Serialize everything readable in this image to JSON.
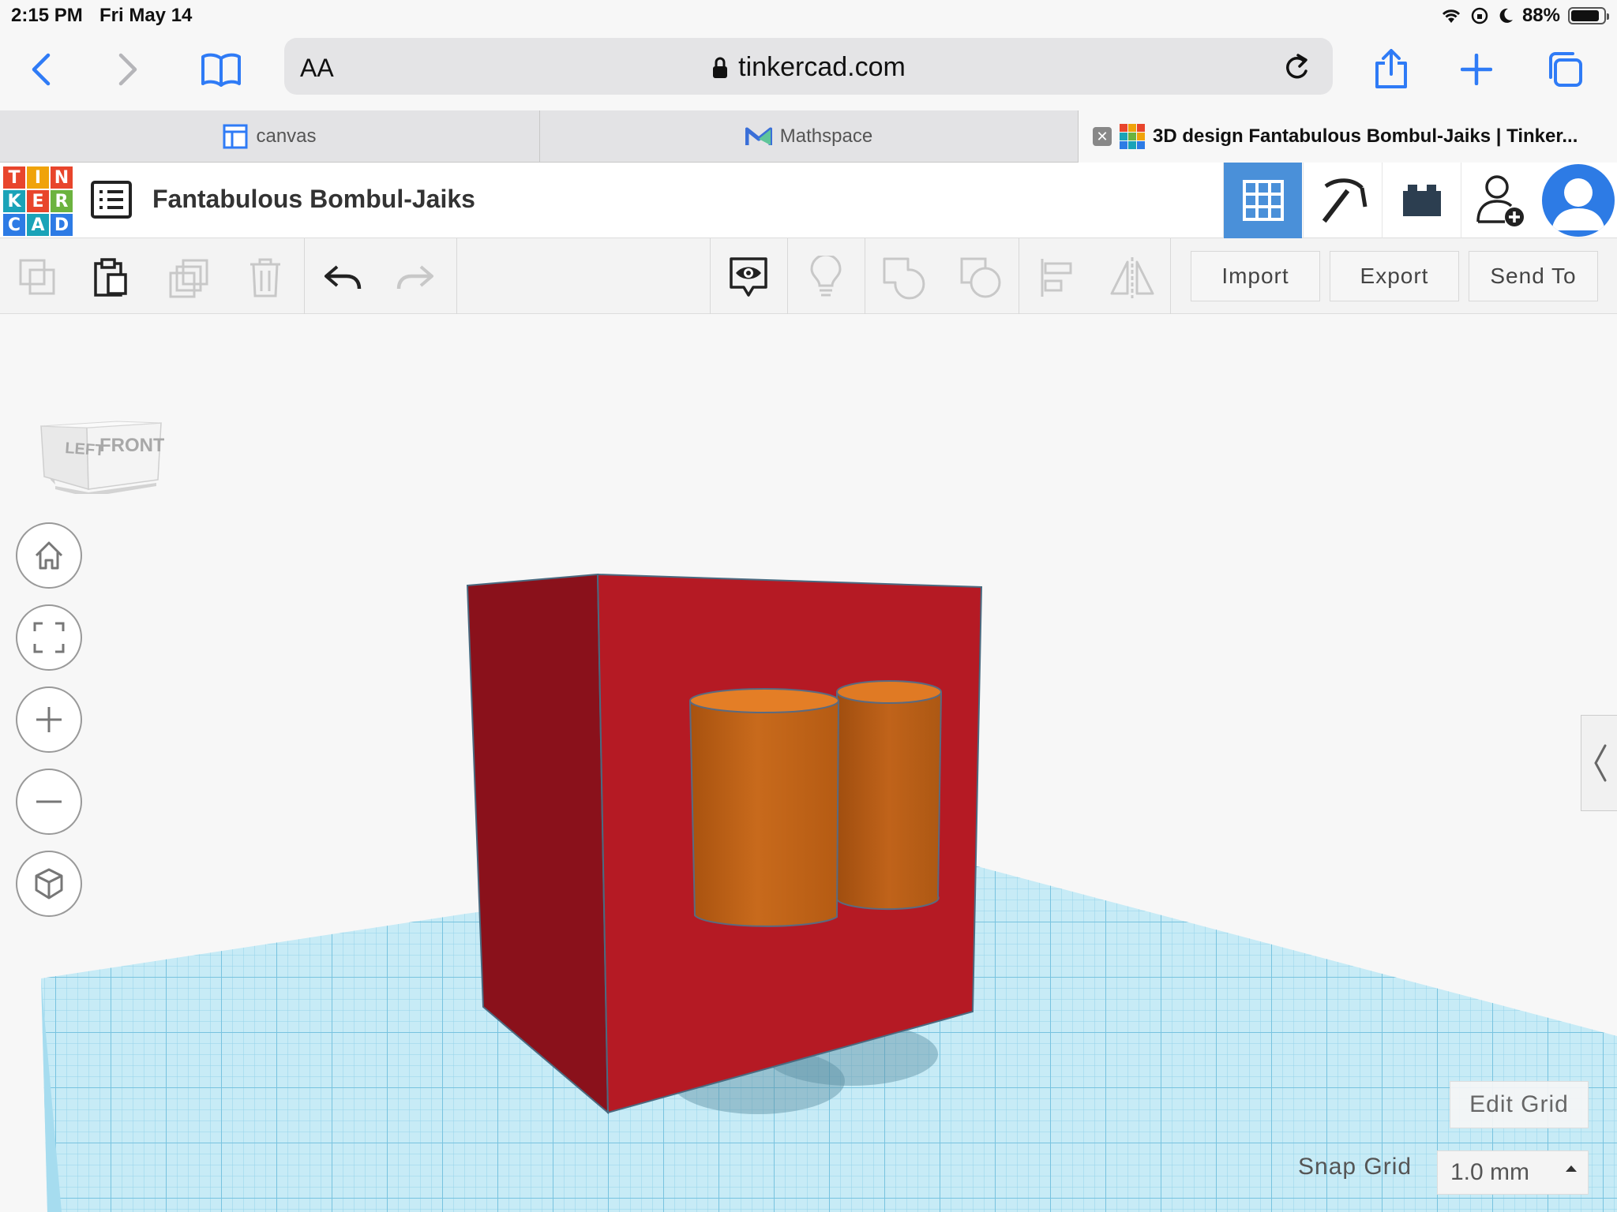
{
  "status_bar": {
    "time": "2:15 PM",
    "date": "Fri May 14",
    "battery": "88%",
    "battery_level": 0.88
  },
  "safari": {
    "text_size_label": "AA",
    "url": "tinkercad.com",
    "tabs": [
      {
        "label": "canvas",
        "icon": "canvas-tab-icon"
      },
      {
        "label": "Mathspace",
        "icon": "mathspace-tab-icon"
      },
      {
        "label": "3D design Fantabulous Bombul-Jaiks | Tinker...",
        "icon": "tinkercad-tab-icon",
        "active": true
      }
    ]
  },
  "tinkercad": {
    "logo": [
      "T",
      "I",
      "N",
      "K",
      "E",
      "R",
      "C",
      "A",
      "D"
    ],
    "design_title": "Fantabulous Bombul-Jaiks",
    "toolbar": {
      "import_label": "Import",
      "export_label": "Export",
      "send_to_label": "Send To"
    },
    "viewcube": {
      "left_face": "LEFT",
      "front_face": "FRONT"
    },
    "edit_grid_label": "Edit Grid",
    "snap_grid_label": "Snap Grid",
    "snap_grid_value": "1.0 mm"
  },
  "colors": {
    "box_front": "#b51a24",
    "box_side": "#8a111b",
    "cylinder": "#c8691c",
    "workplane": "#bfe6f4",
    "accent": "#2d7be5"
  }
}
